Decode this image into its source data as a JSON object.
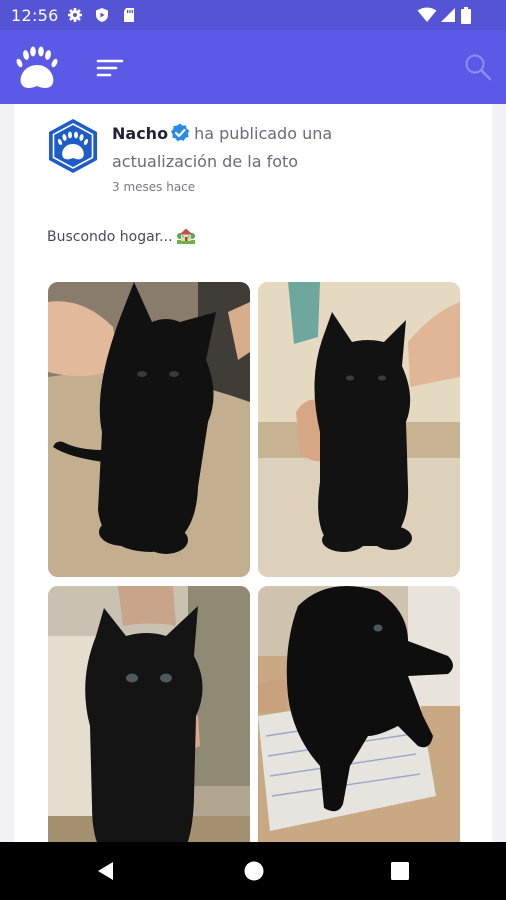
{
  "status_bar": {
    "time": "12:56",
    "icons": [
      "gear-icon",
      "play-shield-icon",
      "sd-card-icon",
      "wifi-icon",
      "signal-icon",
      "battery-icon"
    ]
  },
  "app_bar": {
    "logo": "paw-logo",
    "menu": "menu-icon",
    "search": "search-icon"
  },
  "post": {
    "user_name": "Nacho",
    "verified": true,
    "action_text": "ha publicado una actualización de la foto",
    "timestamp": "3 meses hace",
    "text": "Buscondo hogar...",
    "text_emoji": "house-with-garden-icon",
    "photos": [
      {
        "name": "photo-black-kitten-1"
      },
      {
        "name": "photo-black-kitten-2"
      },
      {
        "name": "photo-black-kitten-3"
      },
      {
        "name": "photo-black-kitten-4"
      }
    ]
  },
  "nav_bar": {
    "buttons": [
      "back-icon",
      "home-icon",
      "recents-icon"
    ]
  },
  "colors": {
    "status_bar": "#5454d4",
    "app_bar": "#5a5ae6",
    "logo_blue": "#1e5cc8",
    "verified_blue": "#2a8ae6",
    "page_background": "#f2f2f6"
  }
}
